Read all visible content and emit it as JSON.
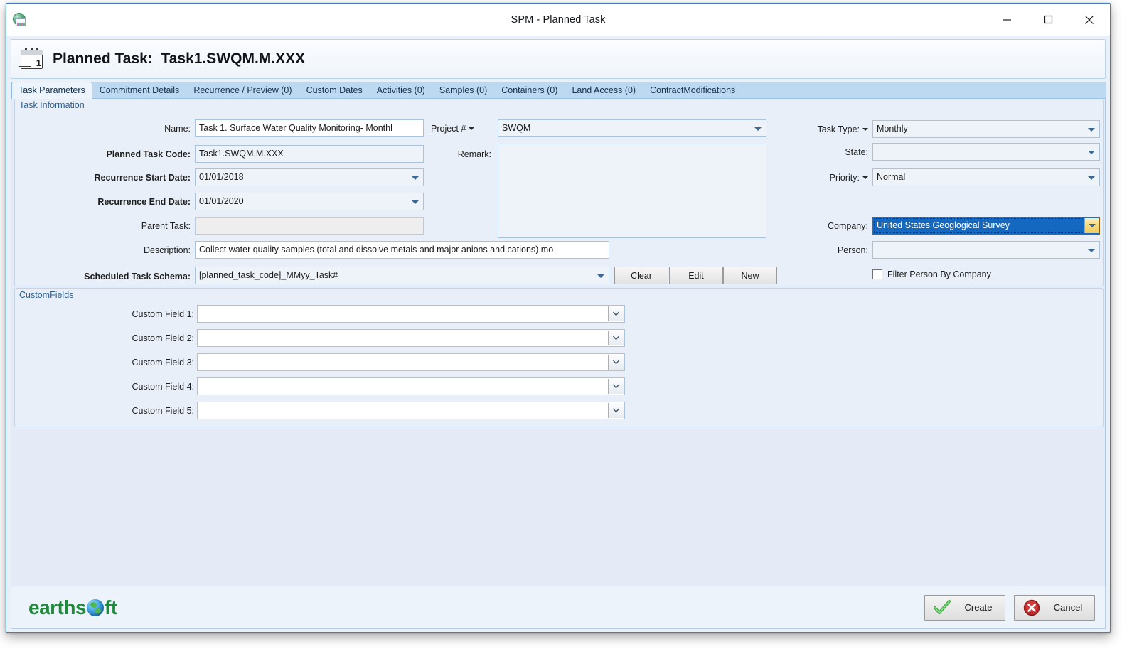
{
  "window": {
    "title": "SPM - Planned Task",
    "app_icon": "globe-document-icon",
    "minimize_label": "Minimize",
    "maximize_label": "Maximize",
    "close_label": "Close"
  },
  "header": {
    "icon": "calendar-task-icon",
    "title": "Planned Task:  Task1.SWQM.M.XXX"
  },
  "tabs": [
    {
      "label": "Task Parameters",
      "active": true
    },
    {
      "label": "Commitment Details",
      "active": false
    },
    {
      "label": "Recurrence / Preview (0)",
      "active": false
    },
    {
      "label": "Custom Dates",
      "active": false
    },
    {
      "label": "Activities (0)",
      "active": false
    },
    {
      "label": "Samples (0)",
      "active": false
    },
    {
      "label": "Containers (0)",
      "active": false
    },
    {
      "label": "Land Access (0)",
      "active": false
    },
    {
      "label": "ContractModifications",
      "active": false
    }
  ],
  "task_information": {
    "group_label": "Task Information",
    "fields": {
      "name": {
        "label": "Name:",
        "value": "Task 1. Surface Water Quality Monitoring- Monthl"
      },
      "planned_task_code": {
        "label": "Planned Task Code:",
        "value": "Task1.SWQM.M.XXX"
      },
      "recurrence_start_date": {
        "label": "Recurrence Start Date:",
        "value": "01/01/2018"
      },
      "recurrence_end_date": {
        "label": "Recurrence End Date:",
        "value": "01/01/2020"
      },
      "parent_task": {
        "label": "Parent Task:",
        "value": ""
      },
      "description": {
        "label": "Description:",
        "value": "Collect water quality samples (total and dissolve metals and major anions and cations) mo"
      },
      "scheduled_task_schema": {
        "label": "Scheduled Task Schema:",
        "value": "[planned_task_code]_MMyy_Task#"
      },
      "project_number": {
        "label": "Project #",
        "value": "SWQM"
      },
      "remark": {
        "label": "Remark:",
        "value": ""
      },
      "task_type": {
        "label": "Task Type:",
        "value": "Monthly"
      },
      "state": {
        "label": "State:",
        "value": ""
      },
      "priority": {
        "label": "Priority:",
        "value": "Normal"
      },
      "company": {
        "label": "Company:",
        "value": "United States Geoglogical Survey"
      },
      "person": {
        "label": "Person:",
        "value": ""
      },
      "filter_person_by_company": {
        "label": "Filter Person By Company",
        "checked": false
      }
    },
    "schema_buttons": {
      "clear": "Clear",
      "edit": "Edit",
      "new": "New"
    }
  },
  "custom_fields": {
    "group_label": "CustomFields",
    "rows": [
      {
        "label": "Custom Field 1:",
        "value": ""
      },
      {
        "label": "Custom Field 2:",
        "value": ""
      },
      {
        "label": "Custom Field 3:",
        "value": ""
      },
      {
        "label": "Custom Field 4:",
        "value": ""
      },
      {
        "label": "Custom Field 5:",
        "value": ""
      }
    ]
  },
  "footer": {
    "brand": "earths",
    "brand_tail": "ft",
    "create_label": "Create",
    "cancel_label": "Cancel"
  },
  "colors": {
    "accent_blue": "#1568c0",
    "tabstrip": "#bdd9f1",
    "panel": "#e9eff8",
    "group_label_text": "#2f6192",
    "brand_green": "#1f8b3a",
    "cancel_red": "#c02a2a",
    "check_green": "#3faa3f"
  }
}
